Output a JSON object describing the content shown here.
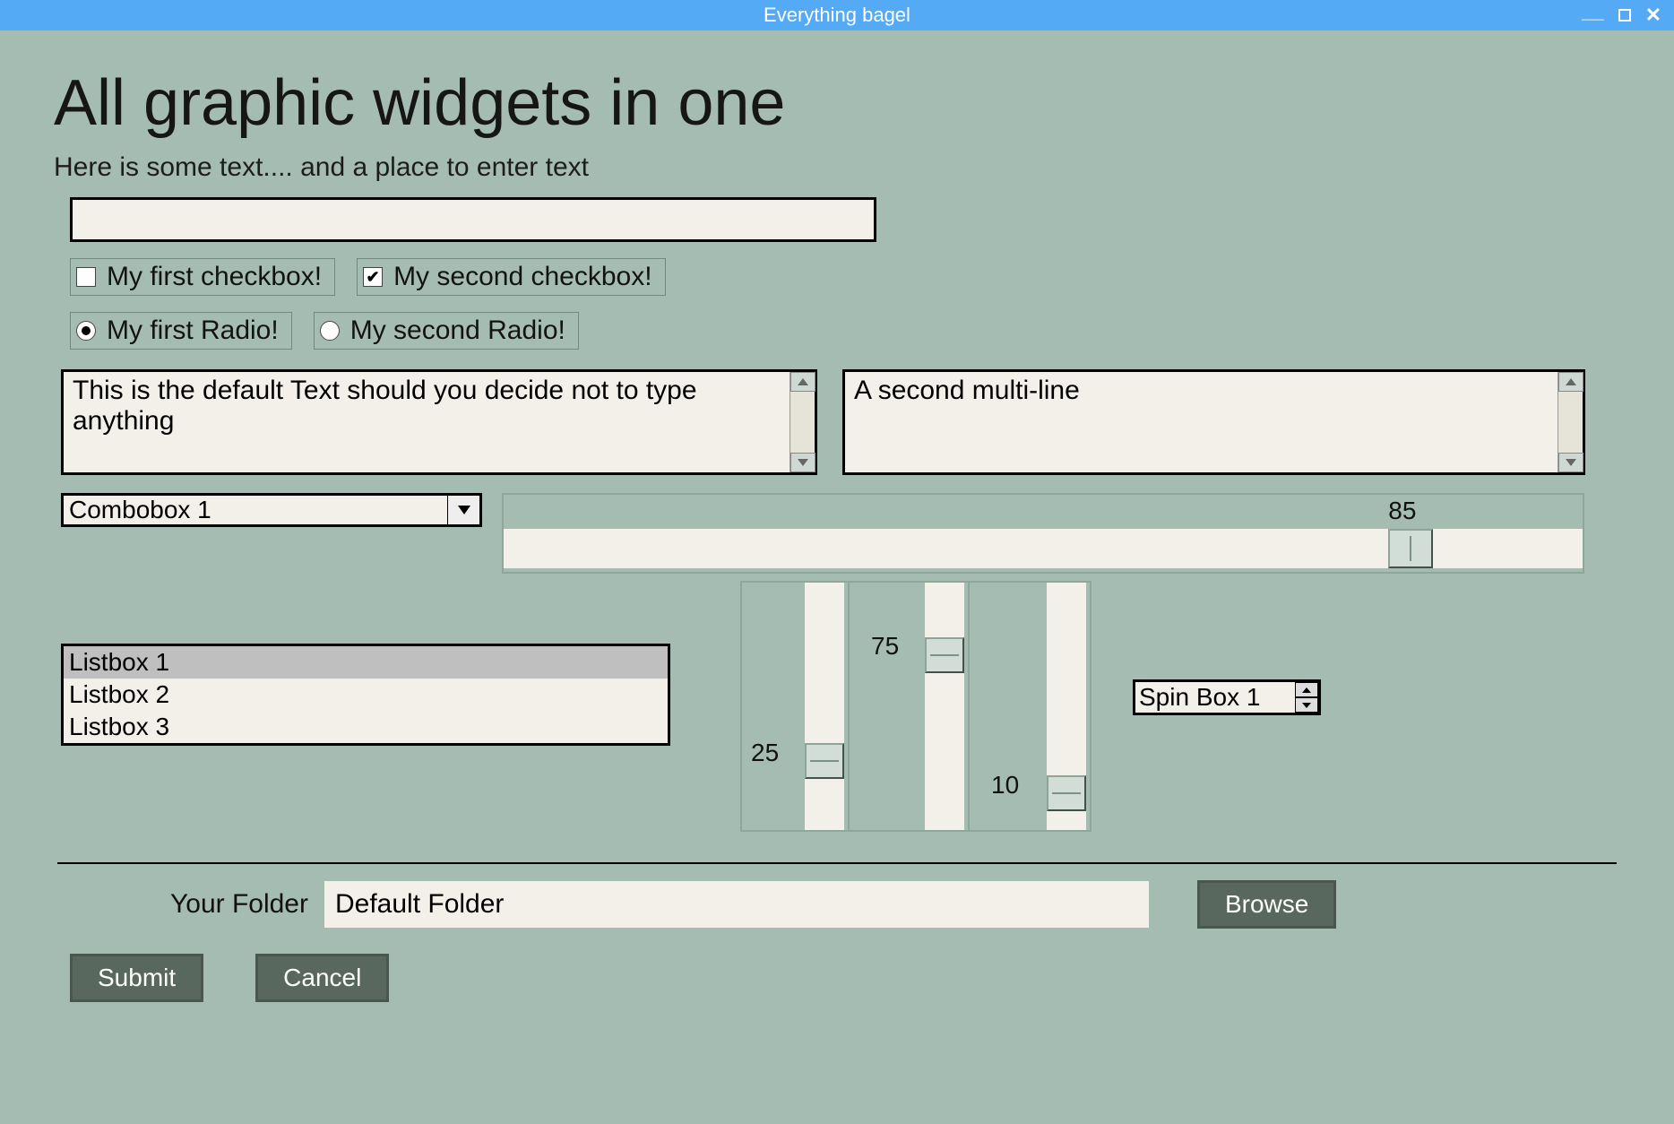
{
  "window": {
    "title": "Everything bagel"
  },
  "heading": "All graphic widgets in one",
  "subtitle": "Here is some text.... and a place to enter text",
  "text_input": {
    "value": ""
  },
  "checkboxes": {
    "first": {
      "label": "My first checkbox!",
      "checked": false
    },
    "second": {
      "label": "My second checkbox!",
      "checked": true
    }
  },
  "radios": {
    "first": {
      "label": "My first Radio!",
      "selected": true
    },
    "second": {
      "label": "My second Radio!",
      "selected": false
    }
  },
  "multiline": {
    "first": "This is the default Text should you decide not to type anything",
    "second": "A second multi-line"
  },
  "combo": {
    "selected": "Combobox 1"
  },
  "hslider": {
    "value": 85
  },
  "listbox": {
    "items": [
      "Listbox 1",
      "Listbox 2",
      "Listbox 3"
    ],
    "selected_index": 0
  },
  "vsliders": {
    "s1": {
      "value": 25
    },
    "s2": {
      "value": 75
    },
    "s3": {
      "value": 10
    }
  },
  "spin": {
    "value": "Spin Box 1"
  },
  "folder": {
    "label": "Your Folder",
    "value": "Default Folder",
    "browse_label": "Browse"
  },
  "buttons": {
    "submit": "Submit",
    "cancel": "Cancel"
  }
}
